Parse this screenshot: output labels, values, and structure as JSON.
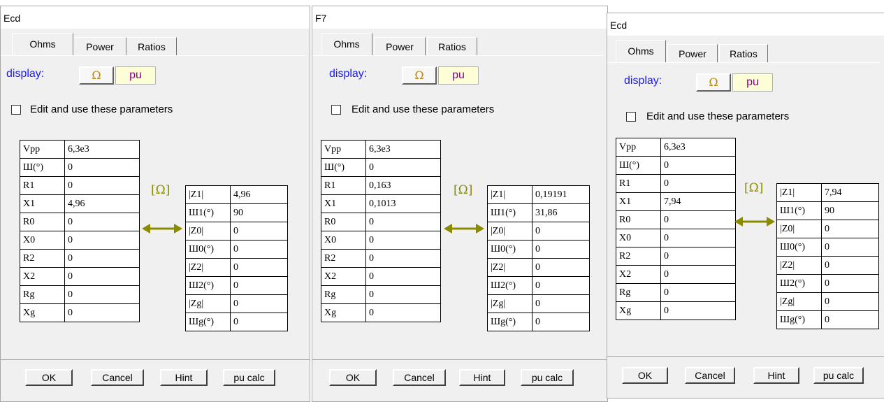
{
  "dialogs": [
    {
      "title": "Ecd",
      "tabs": [
        "Ohms",
        "Power",
        "Ratios"
      ],
      "display_label": "display:",
      "ohm_label": "Ω",
      "pu_label": "pu",
      "checkbox_label": "Edit and use these parameters",
      "unit": "[Ω]",
      "left_table": [
        {
          "label": "Vpp",
          "value": "6,3e3"
        },
        {
          "label": "Ш(°)",
          "value": "0"
        },
        {
          "label": "R1",
          "value": "0"
        },
        {
          "label": "X1",
          "value": "4,96"
        },
        {
          "label": "R0",
          "value": "0"
        },
        {
          "label": "X0",
          "value": "0"
        },
        {
          "label": "R2",
          "value": "0"
        },
        {
          "label": "X2",
          "value": "0"
        },
        {
          "label": "Rg",
          "value": "0"
        },
        {
          "label": "Xg",
          "value": "0"
        }
      ],
      "right_table": [
        {
          "label": "|Z1|",
          "value": "4,96"
        },
        {
          "label": "Ш1(°)",
          "value": "90"
        },
        {
          "label": "|Z0|",
          "value": "0"
        },
        {
          "label": "Ш0(°)",
          "value": "0"
        },
        {
          "label": "|Z2|",
          "value": "0"
        },
        {
          "label": "Ш2(°)",
          "value": "0"
        },
        {
          "label": "|Zg|",
          "value": "0"
        },
        {
          "label": "Шg(°)",
          "value": "0"
        }
      ],
      "buttons": [
        "OK",
        "Cancel",
        "Hint",
        "pu calc"
      ]
    },
    {
      "title": "F7",
      "tabs": [
        "Ohms",
        "Power",
        "Ratios"
      ],
      "display_label": "display:",
      "ohm_label": "Ω",
      "pu_label": "pu",
      "checkbox_label": "Edit and use these parameters",
      "unit": "[Ω]",
      "left_table": [
        {
          "label": "Vpp",
          "value": "6,3e3"
        },
        {
          "label": "Ш(°)",
          "value": "0"
        },
        {
          "label": "R1",
          "value": "0,163"
        },
        {
          "label": "X1",
          "value": "0,1013"
        },
        {
          "label": "R0",
          "value": "0"
        },
        {
          "label": "X0",
          "value": "0"
        },
        {
          "label": "R2",
          "value": "0"
        },
        {
          "label": "X2",
          "value": "0"
        },
        {
          "label": "Rg",
          "value": "0"
        },
        {
          "label": "Xg",
          "value": "0"
        }
      ],
      "right_table": [
        {
          "label": "|Z1|",
          "value": "0,19191"
        },
        {
          "label": "Ш1(°)",
          "value": "31,86"
        },
        {
          "label": "|Z0|",
          "value": "0"
        },
        {
          "label": "Ш0(°)",
          "value": "0"
        },
        {
          "label": "|Z2|",
          "value": "0"
        },
        {
          "label": "Ш2(°)",
          "value": "0"
        },
        {
          "label": "|Zg|",
          "value": "0"
        },
        {
          "label": "Шg(°)",
          "value": "0"
        }
      ],
      "buttons": [
        "OK",
        "Cancel",
        "Hint",
        "pu calc"
      ]
    },
    {
      "title": "Ecd",
      "tabs": [
        "Ohms",
        "Power",
        "Ratios"
      ],
      "display_label": "display:",
      "ohm_label": "Ω",
      "pu_label": "pu",
      "checkbox_label": "Edit and use these parameters",
      "unit": "[Ω]",
      "left_table": [
        {
          "label": "Vpp",
          "value": "6,3e3"
        },
        {
          "label": "Ш(°)",
          "value": "0"
        },
        {
          "label": "R1",
          "value": "0"
        },
        {
          "label": "X1",
          "value": "7,94"
        },
        {
          "label": "R0",
          "value": "0"
        },
        {
          "label": "X0",
          "value": "0"
        },
        {
          "label": "R2",
          "value": "0"
        },
        {
          "label": "X2",
          "value": "0"
        },
        {
          "label": "Rg",
          "value": "0"
        },
        {
          "label": "Xg",
          "value": "0"
        }
      ],
      "right_table": [
        {
          "label": "|Z1|",
          "value": "7,94"
        },
        {
          "label": "Ш1(°)",
          "value": "90"
        },
        {
          "label": "|Z0|",
          "value": "0"
        },
        {
          "label": "Ш0(°)",
          "value": "0"
        },
        {
          "label": "|Z2|",
          "value": "0"
        },
        {
          "label": "Ш2(°)",
          "value": "0"
        },
        {
          "label": "|Zg|",
          "value": "0"
        },
        {
          "label": "Шg(°)",
          "value": "0"
        }
      ],
      "buttons": [
        "OK",
        "Cancel",
        "Hint",
        "pu calc"
      ]
    }
  ],
  "colors": {
    "display_label": "#1a1aff",
    "ohm_symbol": "#b8860b",
    "pu_text": "#8b008b",
    "arrow": "#8b8b00"
  },
  "icons": {
    "arrow": "double-arrow-icon",
    "checkbox": "checkbox-unchecked-icon"
  }
}
